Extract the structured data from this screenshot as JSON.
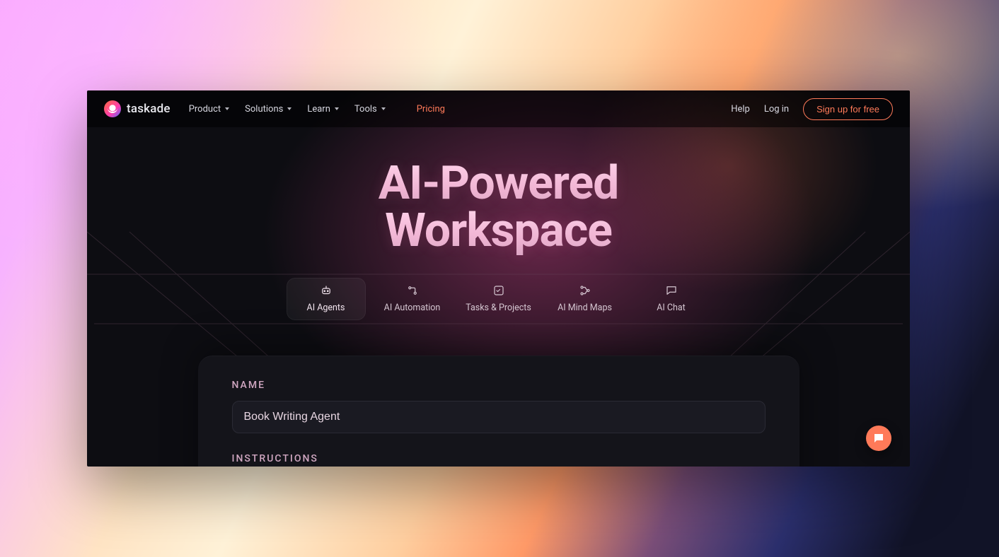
{
  "brand": {
    "name": "taskade"
  },
  "nav": {
    "items": [
      {
        "label": "Product"
      },
      {
        "label": "Solutions"
      },
      {
        "label": "Learn"
      },
      {
        "label": "Tools"
      }
    ],
    "pricing": "Pricing"
  },
  "header_right": {
    "help": "Help",
    "login": "Log in",
    "signup": "Sign up for free"
  },
  "hero": {
    "title_line1": "AI-Powered",
    "title_line2": "Workspace"
  },
  "tabs": [
    {
      "id": "ai-agents",
      "label": "AI Agents",
      "active": true
    },
    {
      "id": "ai-automation",
      "label": "AI Automation",
      "active": false
    },
    {
      "id": "tasks",
      "label": "Tasks & Projects",
      "active": false
    },
    {
      "id": "mindmaps",
      "label": "AI Mind Maps",
      "active": false
    },
    {
      "id": "ai-chat",
      "label": "AI Chat",
      "active": false
    }
  ],
  "card": {
    "name_label": "NAME",
    "name_value": "Book Writing Agent",
    "instructions_label": "INSTRUCTIONS"
  }
}
